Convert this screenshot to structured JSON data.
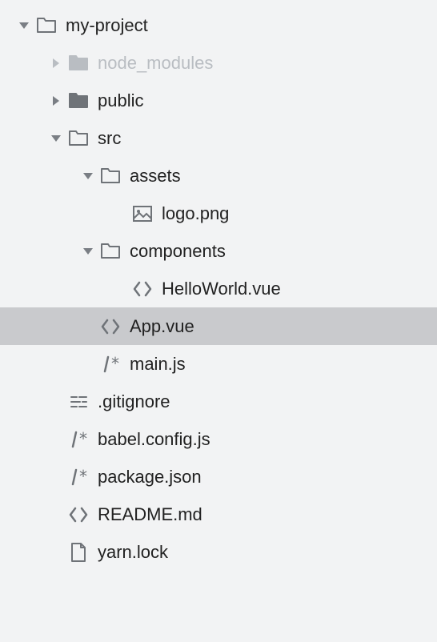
{
  "tree": [
    {
      "label": "my-project",
      "indent": 0,
      "disclosure": "down",
      "icon": "folder-open",
      "dimmed": false,
      "selected": false
    },
    {
      "label": "node_modules",
      "indent": 1,
      "disclosure": "right",
      "icon": "folder-closed",
      "dimmed": true,
      "selected": false
    },
    {
      "label": "public",
      "indent": 1,
      "disclosure": "right",
      "icon": "folder-closed",
      "dimmed": false,
      "selected": false
    },
    {
      "label": "src",
      "indent": 1,
      "disclosure": "down",
      "icon": "folder-open",
      "dimmed": false,
      "selected": false
    },
    {
      "label": "assets",
      "indent": 2,
      "disclosure": "down",
      "icon": "folder-open",
      "dimmed": false,
      "selected": false
    },
    {
      "label": "logo.png",
      "indent": 3,
      "disclosure": "none",
      "icon": "image",
      "dimmed": false,
      "selected": false
    },
    {
      "label": "components",
      "indent": 2,
      "disclosure": "down",
      "icon": "folder-open",
      "dimmed": false,
      "selected": false
    },
    {
      "label": "HelloWorld.vue",
      "indent": 3,
      "disclosure": "none",
      "icon": "code",
      "dimmed": false,
      "selected": false
    },
    {
      "label": "App.vue",
      "indent": 2,
      "disclosure": "none",
      "icon": "code",
      "dimmed": false,
      "selected": true
    },
    {
      "label": "main.js",
      "indent": 2,
      "disclosure": "none",
      "icon": "comment",
      "dimmed": false,
      "selected": false
    },
    {
      "label": ".gitignore",
      "indent": 1,
      "disclosure": "none",
      "icon": "gitignore",
      "dimmed": false,
      "selected": false
    },
    {
      "label": "babel.config.js",
      "indent": 1,
      "disclosure": "none",
      "icon": "comment",
      "dimmed": false,
      "selected": false
    },
    {
      "label": "package.json",
      "indent": 1,
      "disclosure": "none",
      "icon": "comment",
      "dimmed": false,
      "selected": false
    },
    {
      "label": "README.md",
      "indent": 1,
      "disclosure": "none",
      "icon": "code",
      "dimmed": false,
      "selected": false
    },
    {
      "label": "yarn.lock",
      "indent": 1,
      "disclosure": "none",
      "icon": "file",
      "dimmed": false,
      "selected": false
    }
  ]
}
